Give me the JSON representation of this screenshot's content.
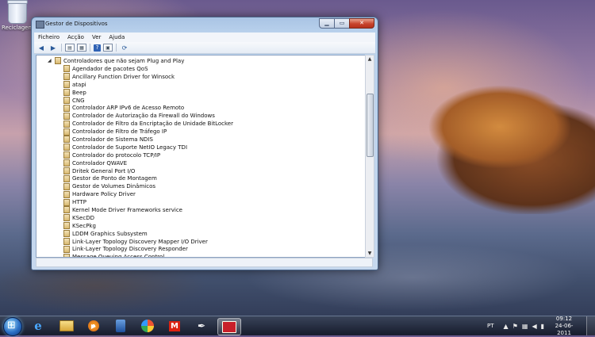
{
  "desktop": {
    "recycle_bin_label": "Reciclagem"
  },
  "window": {
    "title": "Gestor de Dispositivos",
    "menu": [
      "Ficheiro",
      "Acção",
      "Ver",
      "Ajuda"
    ],
    "tree": {
      "category": "Controladores que não sejam Plug and Play",
      "items": [
        "Agendador de pacotes QoS",
        "Ancillary Function Driver for Winsock",
        "atapi",
        "Beep",
        "CNG",
        "Controlador ARP IPv6 de Acesso Remoto",
        "Controlador de Autorização da Firewall do Windows",
        "Controlador de Filtro da Encriptação de Unidade BitLocker",
        "Controlador de Filtro de Tráfego IP",
        "Controlador de Sistema NDIS",
        "Controlador de Suporte NetIO Legacy TDI",
        "Controlador do protocolo TCP/IP",
        "Controlador QWAVE",
        "Dritek General Port I/O",
        "Gestor de Ponto de Montagem",
        "Gestor de Volumes Dinâmicos",
        "Hardware Policy Driver",
        "HTTP",
        "Kernel Mode Driver Frameworks service",
        "KSecDD",
        "KSecPkg",
        "LDDM Graphics Subsystem",
        "Link-Layer Topology Discovery Mapper I/O Driver",
        "Link-Layer Topology Discovery Responder",
        "Message Queuing Access Control"
      ]
    }
  },
  "taskbar": {
    "language": "PT",
    "time": "09:12",
    "date": "24-06-2011"
  },
  "icons": {
    "back": "back-arrow-icon",
    "forward": "forward-arrow-icon",
    "help": "help-icon"
  }
}
